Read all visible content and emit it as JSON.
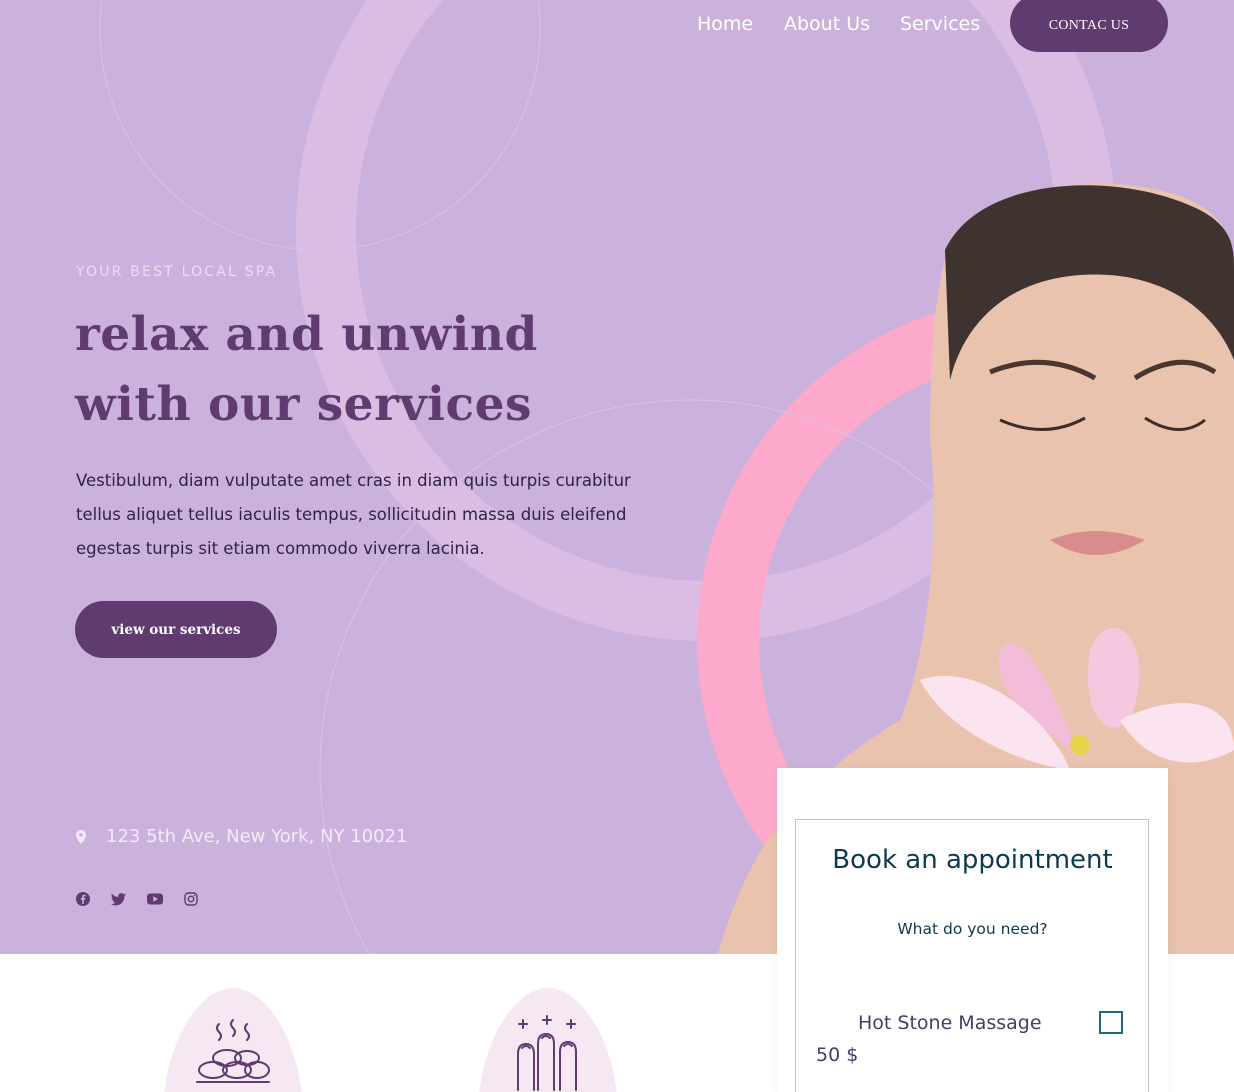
{
  "nav": {
    "items": [
      {
        "label": "Home"
      },
      {
        "label": "About Us"
      },
      {
        "label": "Services"
      }
    ],
    "contact_label": "CONTAC US"
  },
  "hero": {
    "eyebrow": "YOUR BEST LOCAL SPA",
    "headline_line1": "relax and unwind",
    "headline_line2": "with our services",
    "body": "Vestibulum, diam vulputate amet cras in diam quis turpis curabitur tellus aliquet tellus iaculis tempus, sollicitudin massa duis eleifend egestas turpis sit etiam commodo viverra lacinia.",
    "cta_label": "view our services",
    "address": "123 5th Ave, New York, NY 10021",
    "social_icons": [
      "facebook-icon",
      "twitter-icon",
      "youtube-icon",
      "instagram-icon"
    ]
  },
  "booking": {
    "title": "Book an appointment",
    "subtitle": "What do you need?",
    "service": {
      "name": "Hot Stone Massage",
      "price": "50 $",
      "checked": false
    }
  },
  "features": [
    {
      "icon": "hot-stones-icon"
    },
    {
      "icon": "manicure-icon"
    }
  ],
  "colors": {
    "hero_bg": "#cbb2dc",
    "brand_purple": "#5f3b70",
    "accent_pink": "#fda9cb",
    "feature_blob": "#f6e8f2",
    "card_text": "#0e3a4f"
  }
}
